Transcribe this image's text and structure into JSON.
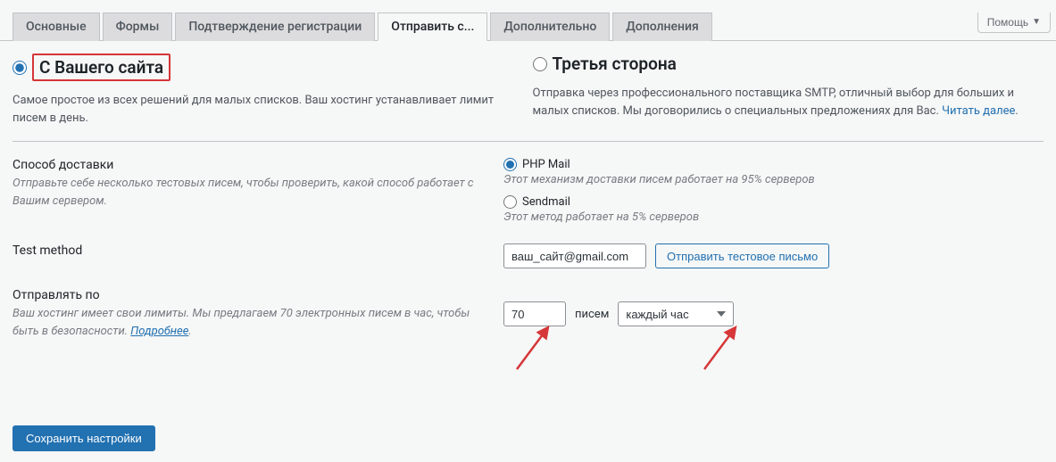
{
  "help_label": "Помощь",
  "tabs": {
    "t0": "Основные",
    "t1": "Формы",
    "t2": "Подтверждение регистрации",
    "t3": "Отправить с...",
    "t4": "Дополнительно",
    "t5": "Дополнения"
  },
  "opt_own": {
    "title": "С Вашего сайта",
    "desc": "Самое простое из всех решений для малых списков. Ваш хостинг устанавливает лимит писем в день."
  },
  "opt_third": {
    "title": "Третья сторона",
    "desc": "Отправка через профессионального поставщика SMTP, отличный выбор для больших и малых списков. Мы договорились о специальных предложениях для Вас. ",
    "link": "Читать далее"
  },
  "delivery": {
    "label": "Способ доставки",
    "hint": "Отправьте себе несколько тестовых писем, чтобы проверить, какой способ работает с Вашим сервером.",
    "phpmail": "PHP Mail",
    "phpmail_hint": "Этот механизм доставки писем работает на 95% серверов",
    "sendmail": "Sendmail",
    "sendmail_hint": "Этот метод работает на 5% серверов"
  },
  "test": {
    "label": "Test method",
    "value": "ваш_сайт@gmail.com",
    "button": "Отправить тестовое письмо"
  },
  "send_by": {
    "label": "Отправлять по",
    "hint": "Ваш хостинг имеет свои лимиты. Мы предлагаем 70 электронных писем в час, чтобы быть в безопасности. ",
    "link": "Подробнее",
    "value": "70",
    "unit": "писем",
    "interval": "каждый час"
  },
  "save_label": "Сохранить настройки"
}
